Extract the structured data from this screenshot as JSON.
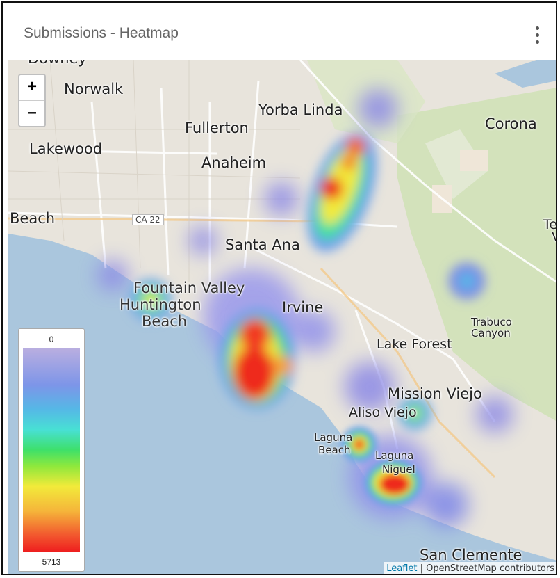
{
  "header": {
    "title": "Submissions - Heatmap",
    "menu_icon": "kebab-menu-icon"
  },
  "map": {
    "zoom_in_label": "+",
    "zoom_out_label": "–",
    "places": {
      "downey": "Downey",
      "norwalk": "Norwalk",
      "yorba_linda": "Yorba Linda",
      "fullerton": "Fullerton",
      "corona": "Corona",
      "lakewood": "Lakewood",
      "anaheim": "Anaheim",
      "beach": "Beach",
      "ca22": "CA 22",
      "santa_ana": "Santa Ana",
      "te": "Te",
      "v": "V",
      "fountain_valley": "Fountain Valley",
      "huntington": "Huntington",
      "beach2": "Beach",
      "irvine": "Irvine",
      "trabuco": "Trabuco",
      "canyon": "Canyon",
      "lake_forest": "Lake Forest",
      "mission_viejo": "Mission Viejo",
      "aliso_viejo": "Aliso Viejo",
      "laguna1": "Laguna",
      "laguna_beach": "Beach",
      "laguna2": "Laguna",
      "niguel": "Niguel",
      "san_clemente": "San Clemente"
    },
    "legend": {
      "min": "0",
      "max": "5713"
    },
    "attribution": {
      "leaflet": "Leaflet",
      "separator": " | ",
      "osm": "OpenStreetMap contributors"
    },
    "colors": {
      "water": "#aac6dd",
      "land": "#e8e4dc",
      "park": "#c9dfae"
    }
  }
}
